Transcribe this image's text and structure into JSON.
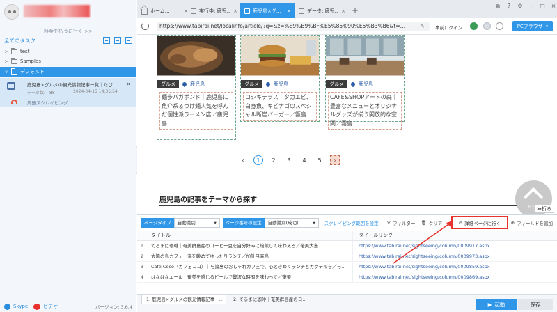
{
  "sidebar": {
    "upgrade_text": "料金を払うに行く >>",
    "task_header": "全てのタスク",
    "tree": [
      {
        "label": "test"
      },
      {
        "label": "Samples"
      },
      {
        "label": "デフォルト"
      }
    ],
    "task": {
      "name": "鹿児島×グルメの観光情報記事一覧｜たびら…",
      "data_label": "データ数:",
      "data_value": "88",
      "date": "2024-04-15 14:35:54",
      "status": "周週スクレイピング…"
    },
    "footer": {
      "skype": "Skype",
      "video": "ビデオ",
      "version": "バージョン: 3.6.4"
    }
  },
  "browser": {
    "tabs": [
      {
        "label": "ホーム…"
      },
      {
        "label": "実行中: 鹿児…"
      },
      {
        "label": "鹿児島×グ…"
      },
      {
        "label": "データ: 鹿児…"
      }
    ],
    "url": "https://www.tabirai.net/localinfo/article/?q=&z=%E9%B9%BF%E5%85%90%E5%B3%B6&t=…",
    "prelogin": "事前ログイン",
    "pc_browser": "PCブラウザ"
  },
  "page": {
    "cards": [
      {
        "category": "グルメ",
        "area": "鹿児島",
        "desc": "麺歩バガボンド｜鹿児島に魚介系＆つけ麺人気を呼んだ個性派ラーメン店／鹿児島"
      },
      {
        "category": "グルメ",
        "area": "鹿児島",
        "desc": "コシキテラス｜タカエビ、白身魚、キビナゴのスペシャル断崖バーガー／甑島"
      },
      {
        "category": "グルメ",
        "area": "鹿児島",
        "desc": "CAFE&SHOPアートの森｜豊富なメニューとオリジナルグッズが揃う開放的な空間／霧島"
      }
    ],
    "pager": [
      "1",
      "2",
      "3",
      "4",
      "5"
    ],
    "section_title": "鹿児島の記事をテーマから探す",
    "scroll_top": "トップ",
    "fold": "≫折る"
  },
  "panel": {
    "page_type_label": "ページタイプ",
    "page_type_value": "自動識別",
    "page_num_label": "ページ番号の設定",
    "page_num_value": "自動識別(成功)",
    "scrape_range": "スクレイピング範囲を設定",
    "filter": "フィルター",
    "clear": "クリア",
    "detail": "詳細ページに行く",
    "add_field": "フィールドを追加",
    "columns": [
      "タイトル",
      "タイトルリンク"
    ],
    "rows": [
      {
        "no": "1",
        "title": "てるまに珈琲｜奄美群島産のコーヒー豆を自分好みに焙煎して味わえる／奄美大島",
        "link": "https://www.tabirai.net/sightseeing/column/0009917.aspx"
      },
      {
        "no": "2",
        "title": "太陽の島カフェ｜海を眺めてゆったりランチ／加計呂麻島",
        "link": "https://www.tabirai.net/sightseeing/column/0009973.aspx"
      },
      {
        "no": "3",
        "title": "Cafe Coco（カフェココ）｜与論島のおしゃれカフェで、心ときめくランチとカクテルを／与…",
        "link": "https://www.tabirai.net/sightseeing/column/0009859.aspx"
      },
      {
        "no": "4",
        "title": "はなはなエール｜奄美を感じるビールで贅沢な時間を味わって／奄美",
        "link": "https://www.tabirai.net/sightseeing/column/0009869.aspx"
      }
    ]
  },
  "footer": {
    "tabs": [
      "1. 鹿児島×グルメの観光情報記事一…",
      "2. てるまに珈琲｜奄美群島産のコ…"
    ],
    "start": "起動",
    "save": "保存"
  }
}
